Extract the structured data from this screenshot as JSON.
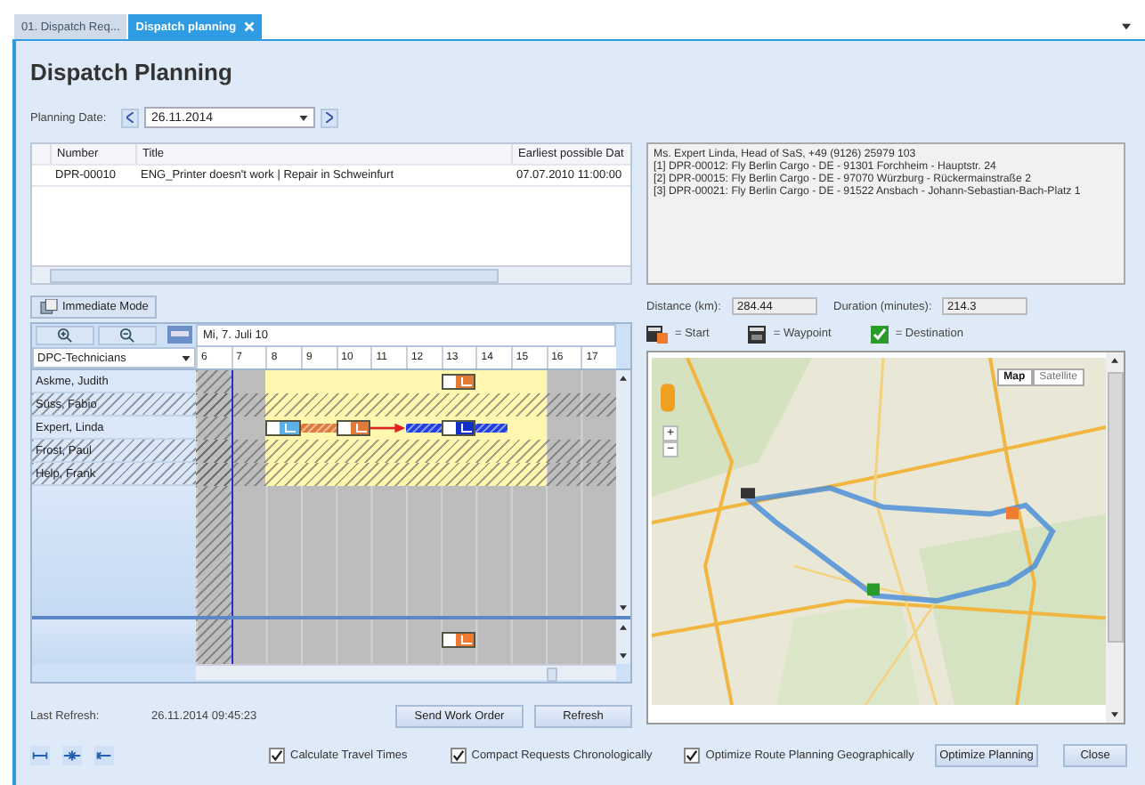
{
  "tabs": [
    {
      "label": "01. Dispatch Req...",
      "selected": false,
      "closable": false
    },
    {
      "label": "Dispatch planning",
      "selected": true,
      "closable": true
    }
  ],
  "title": "Dispatch Planning",
  "planning_date": {
    "label": "Planning Date:",
    "value": "26.11.2014"
  },
  "requests_table": {
    "columns": [
      "Number",
      "Title",
      "Earliest possible Dat"
    ],
    "rows": [
      {
        "cells": [
          "DPR-00010",
          "ENG_Printer doesn't work | Repair in Schweinfurt",
          "07.07.2010 11:00:00"
        ]
      }
    ]
  },
  "immediate_mode": "Immediate Mode",
  "gantt": {
    "date": "Mi, 7. Juli 10",
    "group": "DPC-Technicians",
    "hours": [
      "6",
      "7",
      "8",
      "9",
      "10",
      "11",
      "12",
      "13",
      "14",
      "15",
      "16",
      "17"
    ],
    "rows": [
      {
        "name": "Askme, Judith",
        "available": true,
        "items": [
          {
            "kind": "request",
            "color": "#e07b39"
          }
        ]
      },
      {
        "name": "Süss, Fabio",
        "available": false,
        "items": []
      },
      {
        "name": "Expert, Linda",
        "available": true,
        "items": [
          {
            "kind": "request",
            "color": "#5ab0e8"
          },
          {
            "kind": "travel",
            "color": "#e07b39"
          },
          {
            "kind": "request",
            "color": "#e07b39"
          },
          {
            "kind": "arrow",
            "color": "#e02020"
          },
          {
            "kind": "travel",
            "color": "#2040e0"
          },
          {
            "kind": "request",
            "color": "#1030c8"
          },
          {
            "kind": "travel",
            "color": "#2040e0"
          }
        ]
      },
      {
        "name": "Frost, Paul",
        "available": false,
        "items": []
      },
      {
        "name": "Help, Frank",
        "available": false,
        "items": []
      }
    ],
    "pool_items": [
      {
        "kind": "request",
        "color": "#f07a30"
      }
    ]
  },
  "last_refresh": {
    "label": "Last Refresh:",
    "value": "26.11.2014 09:45:23"
  },
  "left_buttons": [
    "Send Work Order",
    "Refresh"
  ],
  "options": [
    {
      "label": "Calculate Travel Times",
      "checked": true
    },
    {
      "label": "Compact Requests Chronologically",
      "checked": true
    },
    {
      "label": "Optimize Route Planning Geographically",
      "checked": true
    }
  ],
  "actions": [
    "Optimize Planning",
    "Close"
  ],
  "info_lines": [
    "Ms.  Expert Linda, Head of SaS, +49 (9126) 25979 103",
    "[1] DPR-00012: Fly Berlin Cargo - DE - 91301 Forchheim - Hauptstr. 24",
    "[2] DPR-00015: Fly Berlin Cargo - DE - 97070 Würzburg - Rückermainstraße 2",
    "[3] DPR-00021: Fly Berlin Cargo - DE - 91522 Ansbach - Johann-Sebastian-Bach-Platz 1"
  ],
  "distance": {
    "label": "Distance (km):",
    "value": "284.44"
  },
  "duration": {
    "label": "Duration (minutes):",
    "value": "214.3"
  },
  "legend": [
    {
      "kind": "start",
      "label": "= Start"
    },
    {
      "kind": "waypoint",
      "label": "= Waypoint"
    },
    {
      "kind": "destination",
      "label": "= Destination"
    }
  ],
  "map": {
    "kind": "picture",
    "zoom": [
      "+",
      "−"
    ],
    "types": [
      {
        "label": "Map",
        "selected": true
      },
      {
        "label": "Satellite",
        "selected": false
      }
    ]
  }
}
